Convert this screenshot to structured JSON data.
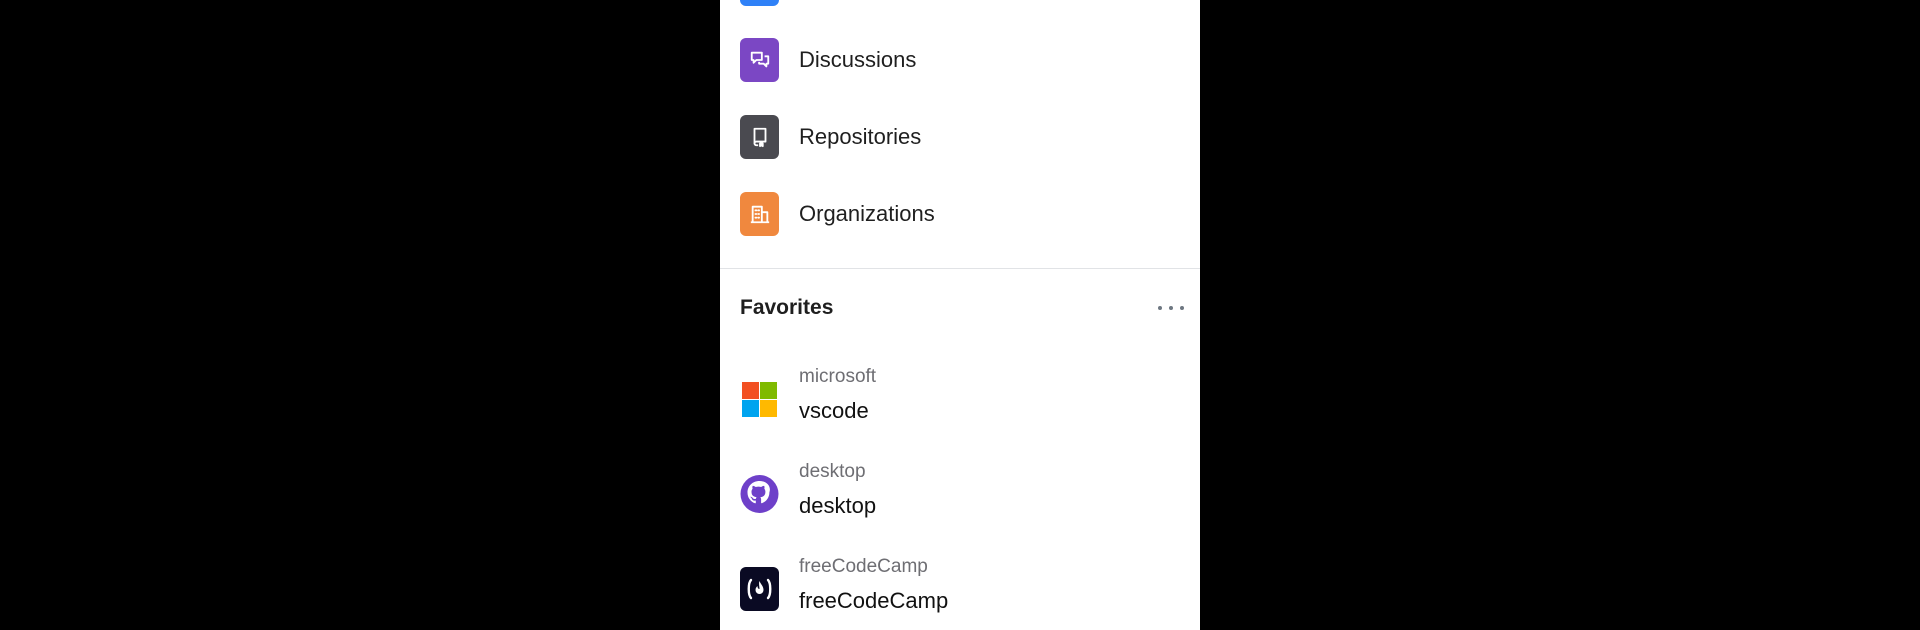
{
  "nav": {
    "items": [
      {
        "label": "Discussions",
        "icon": "discussion-icon",
        "color": "#7b47c4"
      },
      {
        "label": "Repositories",
        "icon": "repo-icon",
        "color": "#4a4a50"
      },
      {
        "label": "Organizations",
        "icon": "organization-icon",
        "color": "#f0883e"
      }
    ],
    "partial_item_color": "#2f81f7"
  },
  "favorites": {
    "title": "Favorites",
    "items": [
      {
        "owner": "microsoft",
        "name": "vscode",
        "avatar": "microsoft-logo-icon"
      },
      {
        "owner": "desktop",
        "name": "desktop",
        "avatar": "github-octocat-icon"
      },
      {
        "owner": "freeCodeCamp",
        "name": "freeCodeCamp",
        "avatar": "freecodecamp-logo-icon"
      }
    ]
  }
}
